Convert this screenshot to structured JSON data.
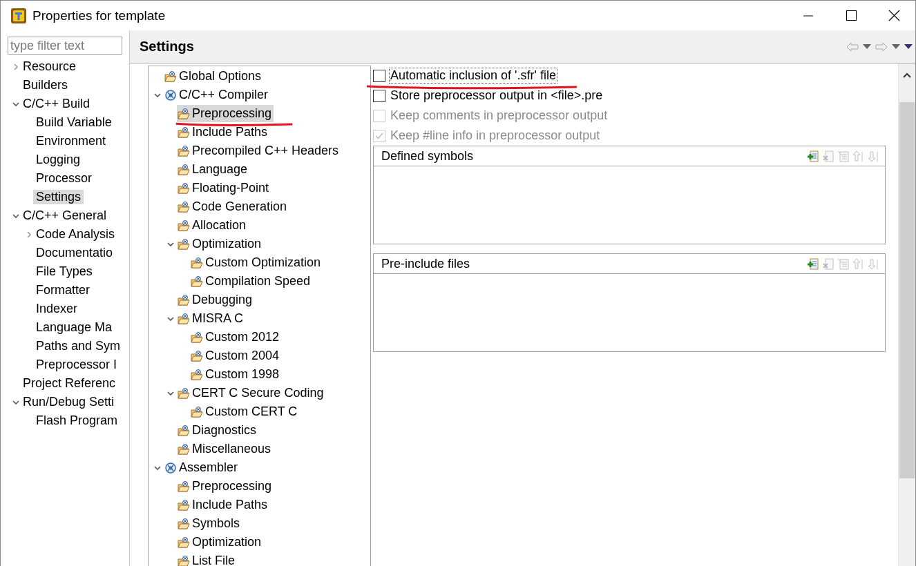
{
  "window": {
    "title": "Properties for template"
  },
  "filter": {
    "placeholder": "type filter text"
  },
  "sidebar": {
    "items": [
      {
        "label": "Resource",
        "selected": false,
        "expanded": false
      },
      {
        "label": "Builders",
        "selected": false
      },
      {
        "label": "C/C++ Build",
        "selected": false,
        "expanded": true,
        "children": [
          {
            "label": "Build Variable",
            "selected": false
          },
          {
            "label": "Environment",
            "selected": false
          },
          {
            "label": "Logging",
            "selected": false
          },
          {
            "label": "Processor",
            "selected": false
          },
          {
            "label": "Settings",
            "selected": true
          }
        ]
      },
      {
        "label": "C/C++ General",
        "selected": false,
        "expanded": true,
        "children": [
          {
            "label": "Code Analysis",
            "selected": false,
            "expanded": false
          },
          {
            "label": "Documentatio",
            "selected": false
          },
          {
            "label": "File Types",
            "selected": false
          },
          {
            "label": "Formatter",
            "selected": false
          },
          {
            "label": "Indexer",
            "selected": false
          },
          {
            "label": "Language Ma",
            "selected": false
          },
          {
            "label": "Paths and Sym",
            "selected": false
          },
          {
            "label": "Preprocessor I",
            "selected": false
          }
        ]
      },
      {
        "label": "Project Referenc",
        "selected": false
      },
      {
        "label": "Run/Debug Setti",
        "selected": false,
        "expanded": true,
        "children": [
          {
            "label": "Flash Program",
            "selected": false
          }
        ]
      }
    ]
  },
  "page": {
    "title": "Settings"
  },
  "tool_tree": {
    "items": [
      {
        "label": "Global Options",
        "kind": "folder",
        "selected": false
      },
      {
        "label": "C/C++ Compiler",
        "kind": "tool",
        "selected": false,
        "expanded": true,
        "children": [
          {
            "label": "Preprocessing",
            "kind": "folder",
            "selected": true,
            "underlined": true
          },
          {
            "label": "Include Paths",
            "kind": "folder",
            "selected": false
          },
          {
            "label": "Precompiled C++ Headers",
            "kind": "folder",
            "selected": false
          },
          {
            "label": "Language",
            "kind": "folder",
            "selected": false
          },
          {
            "label": "Floating-Point",
            "kind": "folder",
            "selected": false
          },
          {
            "label": "Code Generation",
            "kind": "folder",
            "selected": false
          },
          {
            "label": "Allocation",
            "kind": "folder",
            "selected": false
          },
          {
            "label": "Optimization",
            "kind": "folder",
            "selected": false,
            "expanded": true,
            "children": [
              {
                "label": "Custom Optimization",
                "kind": "folder",
                "selected": false
              },
              {
                "label": "Compilation Speed",
                "kind": "folder",
                "selected": false
              }
            ]
          },
          {
            "label": "Debugging",
            "kind": "folder",
            "selected": false
          },
          {
            "label": "MISRA C",
            "kind": "folder",
            "selected": false,
            "expanded": true,
            "children": [
              {
                "label": "Custom 2012",
                "kind": "folder",
                "selected": false
              },
              {
                "label": "Custom 2004",
                "kind": "folder",
                "selected": false
              },
              {
                "label": "Custom 1998",
                "kind": "folder",
                "selected": false
              }
            ]
          },
          {
            "label": "CERT C Secure Coding",
            "kind": "folder",
            "selected": false,
            "expanded": true,
            "children": [
              {
                "label": "Custom CERT C",
                "kind": "folder",
                "selected": false
              }
            ]
          },
          {
            "label": "Diagnostics",
            "kind": "folder",
            "selected": false
          },
          {
            "label": "Miscellaneous",
            "kind": "folder",
            "selected": false
          }
        ]
      },
      {
        "label": "Assembler",
        "kind": "tool",
        "selected": false,
        "expanded": true,
        "children": [
          {
            "label": "Preprocessing",
            "kind": "folder",
            "selected": false
          },
          {
            "label": "Include Paths",
            "kind": "folder",
            "selected": false
          },
          {
            "label": "Symbols",
            "kind": "folder",
            "selected": false
          },
          {
            "label": "Optimization",
            "kind": "folder",
            "selected": false
          },
          {
            "label": "List File",
            "kind": "folder",
            "selected": false
          }
        ]
      }
    ]
  },
  "options": [
    {
      "label": "Automatic inclusion of '.sfr' file",
      "checked": false,
      "disabled": false,
      "underlined": true
    },
    {
      "label": "Store preprocessor output in <file>.pre",
      "checked": false,
      "disabled": false
    },
    {
      "label": "Keep comments in preprocessor output",
      "checked": false,
      "disabled": true
    },
    {
      "label": "Keep #line info in preprocessor output",
      "checked": true,
      "disabled": true
    }
  ],
  "lists": [
    {
      "title": "Defined symbols",
      "tools": [
        {
          "kind": "add",
          "disabled": false
        },
        {
          "kind": "delete",
          "disabled": true
        },
        {
          "kind": "edit",
          "disabled": true
        },
        {
          "kind": "up",
          "disabled": true
        },
        {
          "kind": "down",
          "disabled": true
        }
      ]
    },
    {
      "title": "Pre-include files",
      "tools": [
        {
          "kind": "add",
          "disabled": false
        },
        {
          "kind": "delete",
          "disabled": true
        },
        {
          "kind": "edit",
          "disabled": true
        },
        {
          "kind": "up",
          "disabled": true
        },
        {
          "kind": "down",
          "disabled": true
        }
      ]
    }
  ]
}
